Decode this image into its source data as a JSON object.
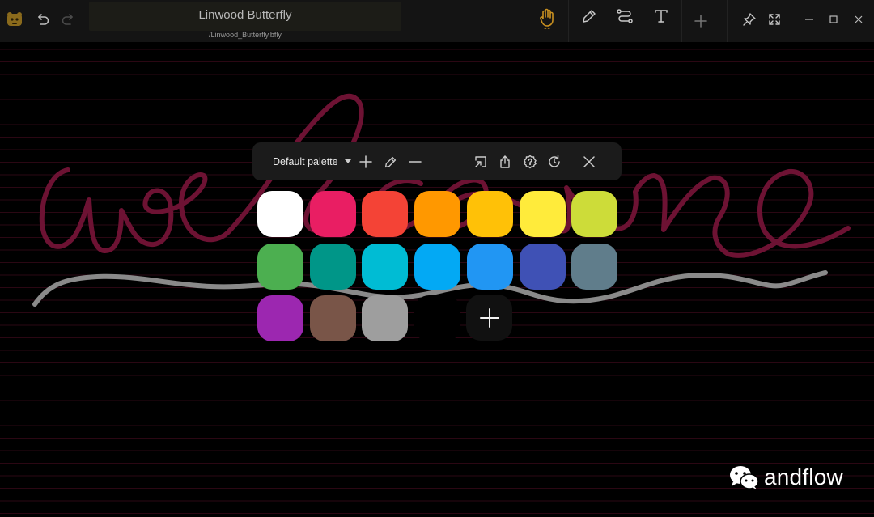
{
  "titlebar": {
    "title": "Linwood Butterfly",
    "path": "/Linwood_Butterfly.bfly"
  },
  "palette": {
    "name": "Default palette",
    "colors": [
      "#ffffff",
      "#e91e63",
      "#f44336",
      "#ff9800",
      "#ffc107",
      "#ffeb3b",
      "#cddc39",
      "#4caf50",
      "#009688",
      "#00bcd4",
      "#03a9f4",
      "#2196f3",
      "#3f51b5",
      "#607d8b",
      "#9c27b0",
      "#795548",
      "#9e9e9e",
      "#000000"
    ]
  },
  "canvas": {
    "handwriting": "welcome",
    "ink_color": "#6d1233",
    "underline_color": "#8a8a8a",
    "line_color": "#3a0a1a"
  },
  "icons": {
    "app": "butterfly-logo-icon",
    "undo": "undo-icon",
    "redo": "redo-icon",
    "hand": "hand-icon",
    "pen": "pen-icon",
    "path": "path-icon",
    "text": "text-icon",
    "add": "add-icon",
    "pin": "pin-icon",
    "fullscreen": "fullscreen-icon",
    "minimize": "minimize-icon",
    "maximize": "maximize-icon",
    "close": "close-icon"
  },
  "watermark": {
    "text": "andflow"
  }
}
